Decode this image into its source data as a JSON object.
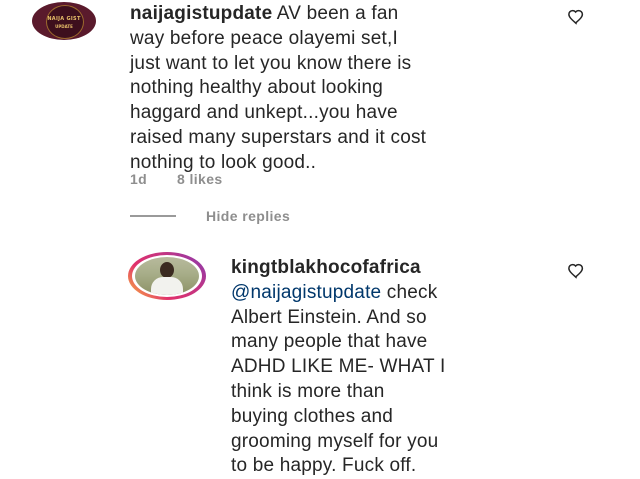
{
  "comment": {
    "avatar_text_top": "NAIJA GIST",
    "avatar_text_bottom": "UPDATE",
    "username": "naijagistupdate",
    "lines": [
      " AV been a fan",
      "way before peace olayemi set,I",
      "just want to let you know there is",
      "nothing healthy about looking",
      "haggard and unkept...you have",
      "raised many superstars and it cost",
      "nothing to look good.."
    ],
    "time": "1d",
    "likes": "8 likes"
  },
  "replies_toggle": {
    "label": "Hide replies"
  },
  "reply": {
    "username": "kingtblakhocofafrica",
    "mention": "@naijagistupdate",
    "lines": [
      " check",
      "Albert Einstein. And so",
      "many people that have",
      "ADHD LIKE ME- WHAT I",
      "think is more than",
      "buying clothes and",
      "grooming myself for you",
      "to be happy. Fuck off."
    ]
  },
  "icons": {
    "like": "heart-outline-icon"
  },
  "colors": {
    "text": "#262626",
    "meta": "#8e8e8e",
    "mention": "#00376b"
  }
}
